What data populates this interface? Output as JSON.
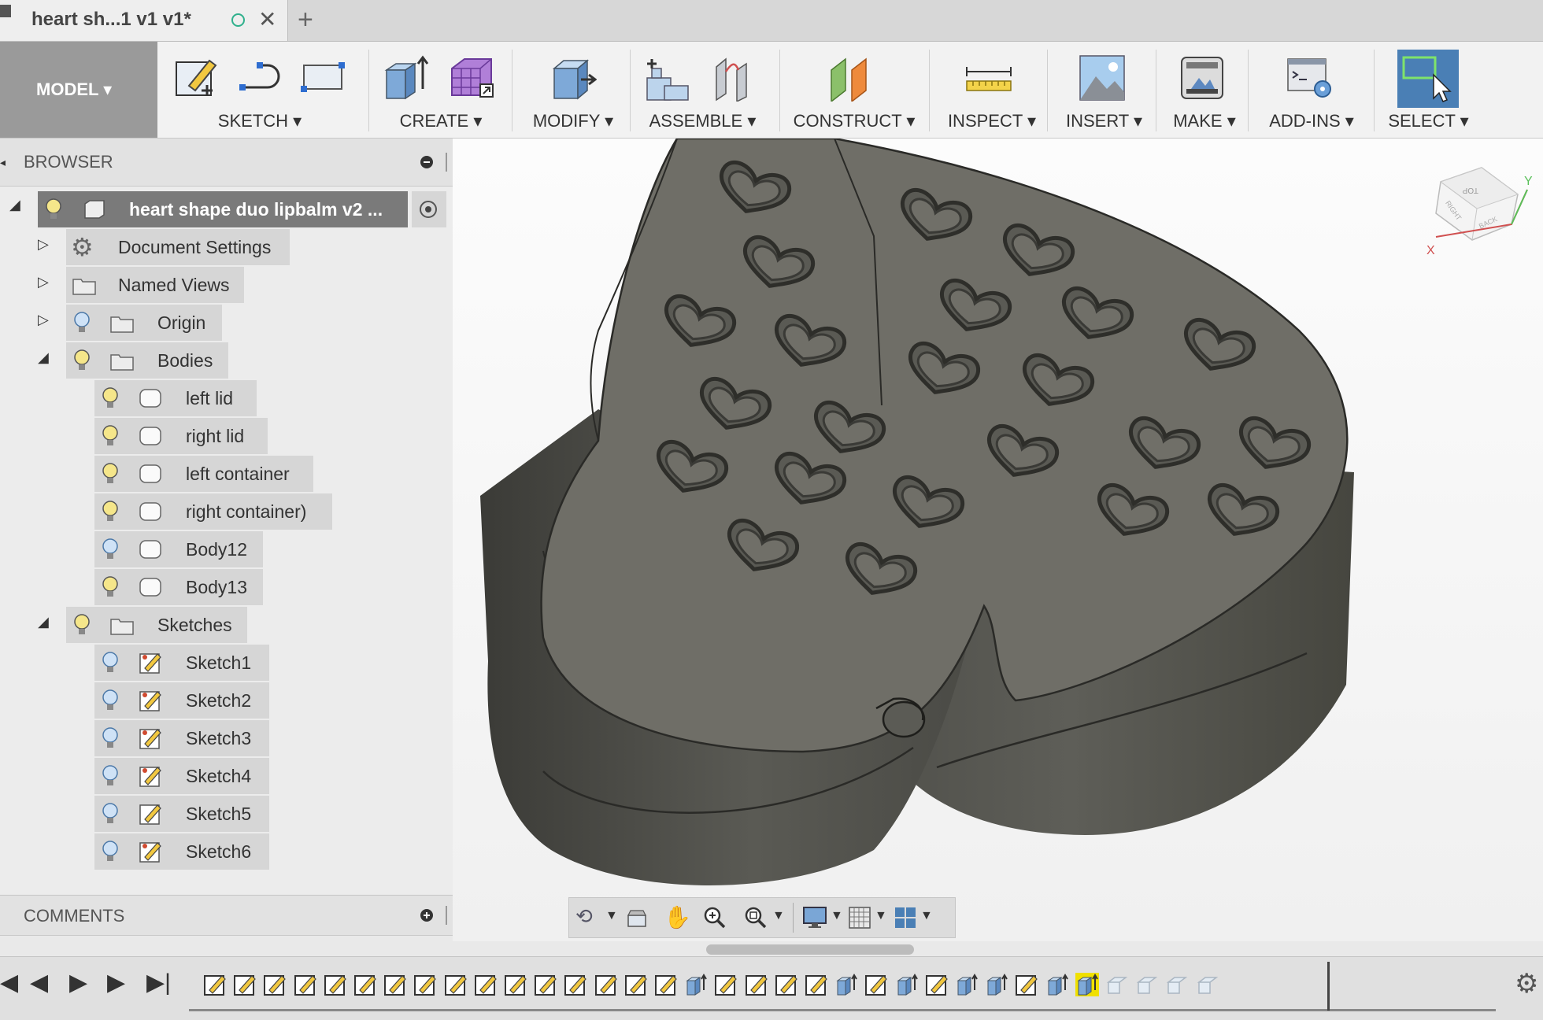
{
  "tab": {
    "title": "heart sh...1 v1 v1*",
    "close": "✕",
    "new": "+"
  },
  "toolbar": {
    "model": "MODEL ▾",
    "groups": [
      {
        "label": "SKETCH ▾"
      },
      {
        "label": "CREATE ▾"
      },
      {
        "label": "MODIFY ▾"
      },
      {
        "label": "ASSEMBLE ▾"
      },
      {
        "label": "CONSTRUCT ▾"
      },
      {
        "label": "INSPECT ▾"
      },
      {
        "label": "INSERT ▾"
      },
      {
        "label": "MAKE ▾"
      },
      {
        "label": "ADD-INS ▾"
      },
      {
        "label": "SELECT ▾"
      }
    ]
  },
  "browser": {
    "title": "BROWSER",
    "root": "heart shape duo lipbalm v2 ...",
    "items": [
      {
        "label": "Document Settings"
      },
      {
        "label": "Named Views"
      },
      {
        "label": "Origin"
      },
      {
        "label": "Bodies"
      },
      {
        "label": "left lid"
      },
      {
        "label": "right lid"
      },
      {
        "label": "left container"
      },
      {
        "label": "right container)"
      },
      {
        "label": "Body12"
      },
      {
        "label": "Body13"
      },
      {
        "label": "Sketches"
      },
      {
        "label": "Sketch1"
      },
      {
        "label": "Sketch2"
      },
      {
        "label": "Sketch3"
      },
      {
        "label": "Sketch4"
      },
      {
        "label": "Sketch5"
      },
      {
        "label": "Sketch6"
      }
    ]
  },
  "comments": {
    "title": "COMMENTS"
  },
  "viewcube": {
    "top": "TOP",
    "right": "RIGHT",
    "back": "BACK",
    "x": "X",
    "y": "Y"
  },
  "colors": {
    "accent": "#4a7fb5",
    "model": "#5a5a54",
    "highlight": "#f0e000"
  },
  "icons": {
    "bulb": "lightbulb-icon",
    "folder": "folder-icon",
    "body": "body-icon",
    "sketch": "sketch-icon",
    "gear": "gear-icon"
  }
}
